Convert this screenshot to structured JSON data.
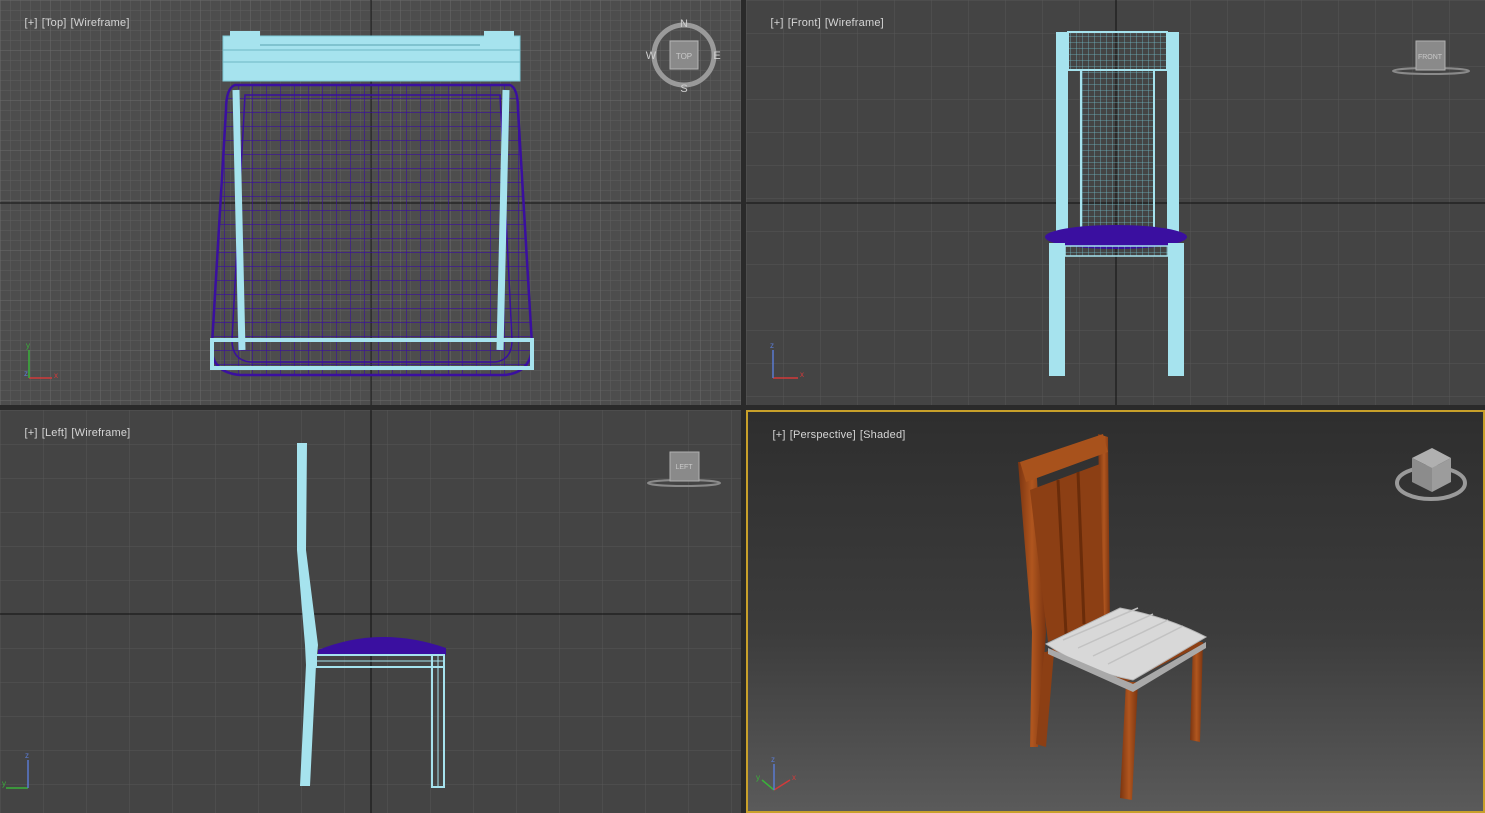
{
  "viewports": {
    "top": {
      "plus": "[+]",
      "view": "[Top]",
      "mode": "[Wireframe]",
      "compass": {
        "n": "N",
        "s": "S",
        "w": "W",
        "e": "E",
        "cube": "TOP"
      }
    },
    "front": {
      "plus": "[+]",
      "view": "[Front]",
      "mode": "[Wireframe]",
      "cube": "FRONT"
    },
    "left": {
      "plus": "[+]",
      "view": "[Left]",
      "mode": "[Wireframe]",
      "cube": "LEFT"
    },
    "perspective": {
      "plus": "[+]",
      "view": "[Perspective]",
      "mode": "[Shaded]",
      "active": true
    }
  },
  "axis_labels": {
    "x": "x",
    "y": "y",
    "z": "z"
  },
  "colors": {
    "wireframe_frame": "#a6e3ee",
    "wireframe_seat": "#3a0fa0",
    "active_border": "#c8a02a",
    "wood": "#9a4a1a",
    "cushion": "#d6d6d6"
  }
}
